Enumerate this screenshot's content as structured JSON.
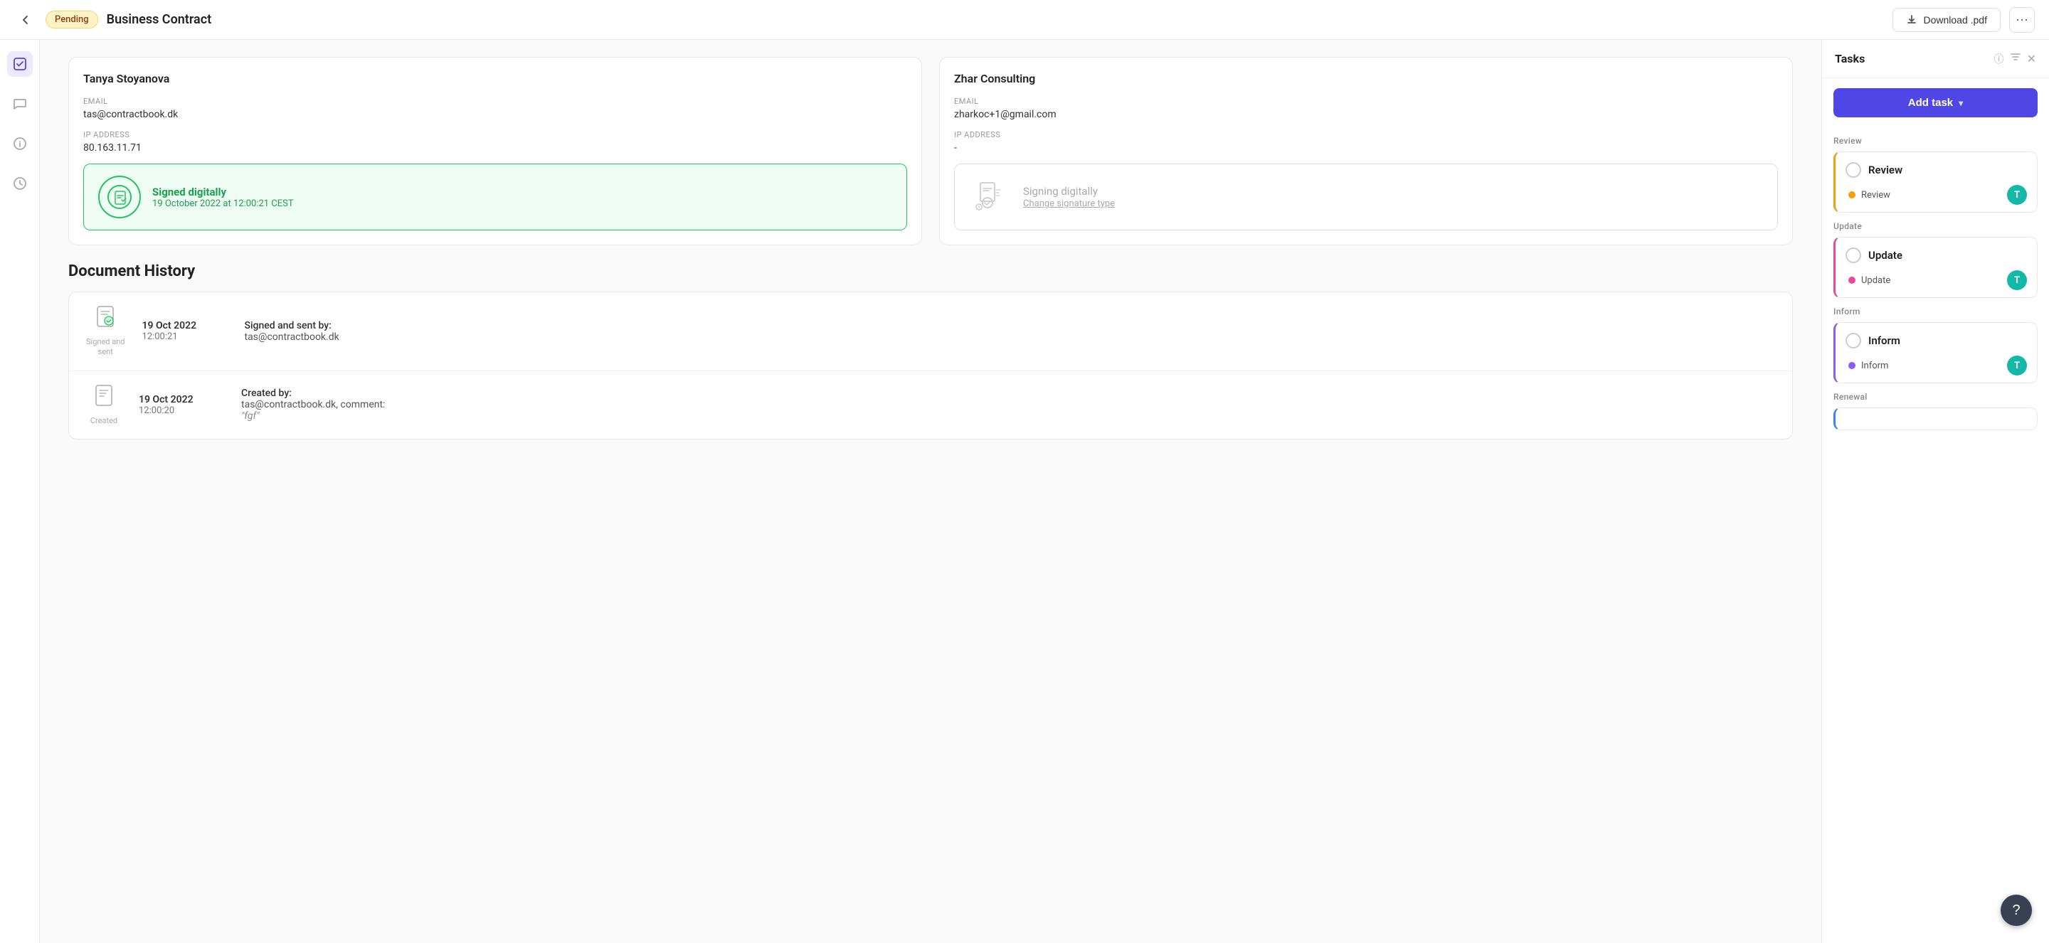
{
  "topbar": {
    "status": "Pending",
    "title": "Business Contract",
    "download_label": "Download .pdf",
    "more_label": "···"
  },
  "left_sidebar": {
    "icons": [
      {
        "name": "tasks-icon",
        "symbol": "☑",
        "active": true
      },
      {
        "name": "comments-icon",
        "symbol": "💬",
        "active": false
      },
      {
        "name": "info-icon",
        "symbol": "ℹ",
        "active": false
      },
      {
        "name": "history-icon",
        "symbol": "🕐",
        "active": false
      }
    ]
  },
  "signatories": [
    {
      "name": "Tanya Stoyanova",
      "email_label": "Email",
      "email": "tas@contractbook.dk",
      "ip_label": "IP Address",
      "ip": "80.163.11.71",
      "signed": true,
      "signed_text": "Signed digitally",
      "signed_date": "19 October 2022 at 12:00:21 CEST"
    },
    {
      "name": "Zhar Consulting",
      "email_label": "Email",
      "email": "zharkoc+1@gmail.com",
      "ip_label": "IP Address",
      "ip": "-",
      "signed": false,
      "pending_text": "Signing digitally",
      "change_link": "Change signature type"
    }
  ],
  "document_history": {
    "section_title": "Document History",
    "items": [
      {
        "icon_label": "Signed and sent",
        "date_main": "19 Oct 2022",
        "date_time": "12:00:21",
        "desc_action": "Signed and sent by:",
        "desc_detail": "tas@contractbook.dk"
      },
      {
        "icon_label": "Created",
        "date_main": "19 Oct 2022",
        "date_time": "12:00:20",
        "desc_action": "Created by:",
        "desc_detail": "tas@contractbook.dk, comment:",
        "desc_comment": "\"fgf\""
      }
    ]
  },
  "tasks_panel": {
    "title": "Tasks",
    "add_task_label": "Add task",
    "sections": [
      {
        "label": "Review",
        "tasks": [
          {
            "name": "Review",
            "sub_label": "Review",
            "dot_color": "yellow",
            "avatar": "T",
            "type": "review"
          }
        ]
      },
      {
        "label": "Update",
        "tasks": [
          {
            "name": "Update",
            "sub_label": "Update",
            "dot_color": "pink",
            "avatar": "T",
            "type": "update"
          }
        ]
      },
      {
        "label": "Inform",
        "tasks": [
          {
            "name": "Inform",
            "sub_label": "Inform",
            "dot_color": "purple",
            "avatar": "T",
            "type": "inform"
          }
        ]
      },
      {
        "label": "Renewal",
        "tasks": []
      }
    ]
  },
  "help": {
    "label": "?"
  }
}
